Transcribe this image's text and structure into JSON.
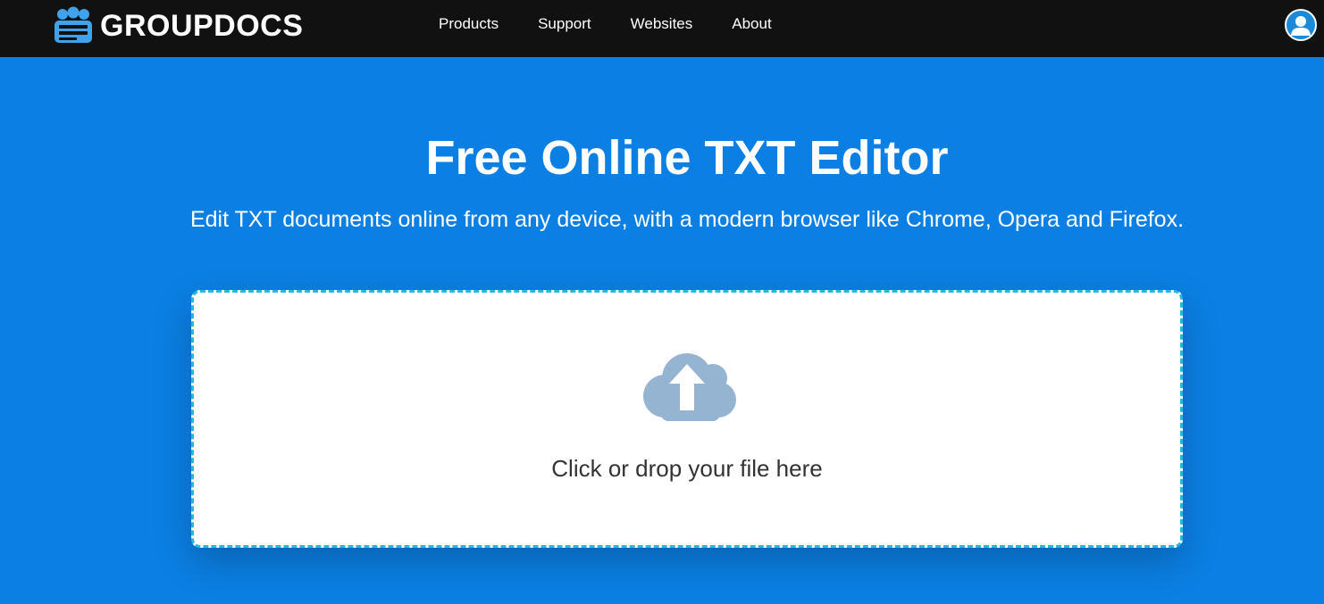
{
  "header": {
    "logo_text": "GROUPDOCS",
    "nav": [
      {
        "label": "Products"
      },
      {
        "label": "Support"
      },
      {
        "label": "Websites"
      },
      {
        "label": "About"
      }
    ]
  },
  "hero": {
    "title": "Free Online TXT Editor",
    "subtitle": "Edit TXT documents online from any device, with a modern browser like Chrome, Opera and Firefox."
  },
  "upload": {
    "label": "Click or drop your file here"
  },
  "icons": {
    "logo": "groupdocs-logo-icon",
    "user": "user-icon",
    "upload": "cloud-upload-icon"
  },
  "colors": {
    "topbar": "#111111",
    "hero_background": "#0b7fe3",
    "dropzone_border": "#27b8e0",
    "upload_icon": "#94b4d1"
  }
}
